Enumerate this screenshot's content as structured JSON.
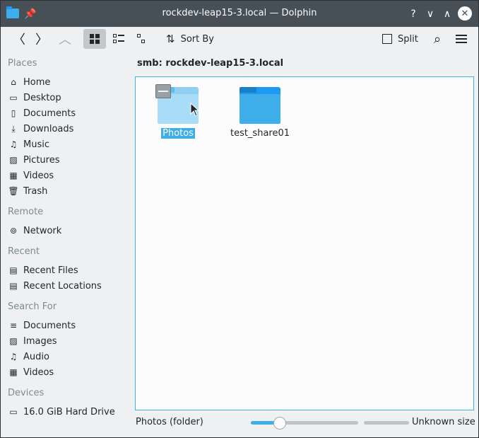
{
  "window": {
    "title": "rockdev-leap15-3.local — Dolphin"
  },
  "titlebar": {
    "help_glyph": "?",
    "minimize_glyph": "∨",
    "maximize_glyph": "∧",
    "close_glyph": "✕",
    "pin_glyph": "📌"
  },
  "toolbar": {
    "sort_label": "Sort By",
    "split_label": "Split",
    "back_glyph": "〈",
    "forward_glyph": "〉",
    "up_glyph": "︿",
    "search_glyph": "⌕"
  },
  "sidebar": {
    "places_heading": "Places",
    "places": [
      {
        "label": "Home",
        "icon": "home-icon",
        "glyph": "⌂"
      },
      {
        "label": "Desktop",
        "icon": "desktop-icon",
        "glyph": "▭"
      },
      {
        "label": "Documents",
        "icon": "documents-icon",
        "glyph": "▯"
      },
      {
        "label": "Downloads",
        "icon": "downloads-icon",
        "glyph": "⤓"
      },
      {
        "label": "Music",
        "icon": "music-icon",
        "glyph": "♫"
      },
      {
        "label": "Pictures",
        "icon": "pictures-icon",
        "glyph": "▨"
      },
      {
        "label": "Videos",
        "icon": "videos-icon",
        "glyph": "▦"
      },
      {
        "label": "Trash",
        "icon": "trash-icon",
        "glyph": "🗑"
      }
    ],
    "remote_heading": "Remote",
    "remote": [
      {
        "label": "Network",
        "icon": "network-icon",
        "glyph": "⊚"
      }
    ],
    "recent_heading": "Recent",
    "recent": [
      {
        "label": "Recent Files",
        "icon": "recent-files-icon",
        "glyph": "▤"
      },
      {
        "label": "Recent Locations",
        "icon": "recent-locations-icon",
        "glyph": "▤"
      }
    ],
    "search_heading": "Search For",
    "search": [
      {
        "label": "Documents",
        "icon": "search-documents-icon",
        "glyph": "≡"
      },
      {
        "label": "Images",
        "icon": "search-images-icon",
        "glyph": "▨"
      },
      {
        "label": "Audio",
        "icon": "search-audio-icon",
        "glyph": "♫"
      },
      {
        "label": "Videos",
        "icon": "search-videos-icon",
        "glyph": "▦"
      }
    ],
    "devices_heading": "Devices",
    "devices": [
      {
        "label": "16.0 GiB Hard Drive",
        "icon": "hard-drive-icon",
        "glyph": "▭"
      }
    ]
  },
  "location": {
    "path": "smb: rockdev-leap15-3.local"
  },
  "files": [
    {
      "name": "Photos",
      "selected": true
    },
    {
      "name": "test_share01",
      "selected": false
    }
  ],
  "statusbar": {
    "info": "Photos (folder)",
    "space": "Unknown size",
    "zoom_level": 0.27
  },
  "colors": {
    "accent": "#3daee9",
    "folder_dark": "#1d99f3",
    "folder_light": "#a9dcf6",
    "titlebar": "#475057"
  }
}
